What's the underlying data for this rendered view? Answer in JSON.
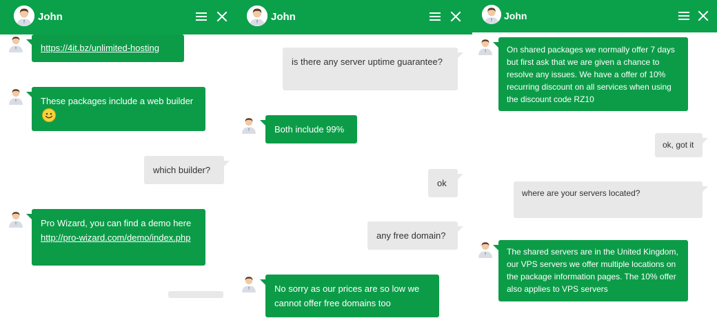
{
  "agent_name": "John",
  "icons": {
    "menu": "hamburger-menu-icon",
    "close": "close-icon",
    "avatar": "agent-avatar-icon",
    "emoji": "smiley-emoji-icon"
  },
  "colors": {
    "header": "#0ba14b",
    "agent_bubble": "#0c9c48",
    "user_bubble": "#e8e8e8"
  },
  "panels": [
    {
      "messages": [
        {
          "from": "agent",
          "link": "https://4it.bz/unlimited-hosting"
        },
        {
          "from": "agent",
          "text": "These packages include a web builder"
        },
        {
          "from": "user",
          "text": "which builder?"
        },
        {
          "from": "agent",
          "text": "Pro Wizard, you can find a demo here",
          "link": "http://pro-wizard.com/demo/index.php"
        }
      ]
    },
    {
      "messages": [
        {
          "from": "user",
          "text": "is there any server uptime guarantee?"
        },
        {
          "from": "agent",
          "text": "Both include 99%"
        },
        {
          "from": "user",
          "text": "ok"
        },
        {
          "from": "user",
          "text": "any free domain?"
        },
        {
          "from": "agent",
          "text": "No sorry as our prices are so low we cannot offer free domains too"
        }
      ]
    },
    {
      "messages": [
        {
          "from": "agent",
          "text": "On shared packages we normally offer 7 days but first ask that we are given a chance to resolve any issues. We have a offer of 10% recurring discount on all services when using the discount code RZ10"
        },
        {
          "from": "user",
          "text": "ok, got it"
        },
        {
          "from": "user",
          "text": "where are your servers located?"
        },
        {
          "from": "agent",
          "text": "The shared servers are in the United Kingdom, our VPS servers we offer multiple locations on the package information pages. The 10% offer also applies to VPS servers"
        }
      ]
    }
  ]
}
